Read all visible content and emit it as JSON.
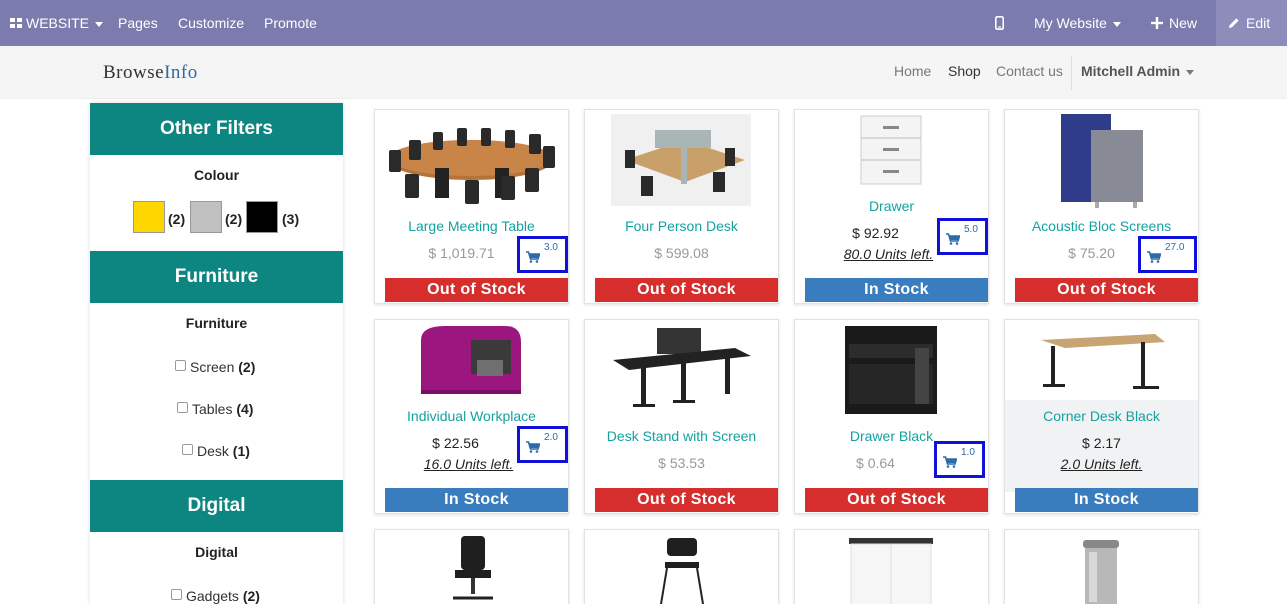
{
  "topbar": {
    "website_menu": "WEBSITE",
    "pages": "Pages",
    "customize": "Customize",
    "promote": "Promote",
    "my_website": "My Website",
    "new": "New",
    "edit": "Edit"
  },
  "nav": {
    "brand_a": "Browse",
    "brand_b": "Info",
    "home": "Home",
    "shop": "Shop",
    "contact": "Contact us",
    "user": "Mitchell Admin"
  },
  "sidebar": {
    "other_filters": "Other Filters",
    "colour_title": "Colour",
    "colours": [
      {
        "hex": "#ffd700",
        "count": "(2)"
      },
      {
        "hex": "#c0c0c0",
        "count": "(2)"
      },
      {
        "hex": "#000000",
        "count": "(3)"
      }
    ],
    "furniture_head": "Furniture",
    "furniture_sub": "Furniture",
    "furniture_items": [
      {
        "label": "Screen",
        "count": "(2)"
      },
      {
        "label": "Tables",
        "count": "(4)"
      },
      {
        "label": "Desk",
        "count": "(1)"
      }
    ],
    "digital_head": "Digital",
    "digital_sub": "Digital",
    "digital_items": [
      {
        "label": "Gadgets",
        "count": "(2)"
      }
    ]
  },
  "products": [
    {
      "name": "Large Meeting Table",
      "price": "$ 1,019.71",
      "stock": "Out of Stock",
      "cart_qty": "3.0",
      "image_icon": "meeting-table-image"
    },
    {
      "name": "Four Person Desk",
      "price": "$ 599.08",
      "stock": "Out of Stock",
      "image_icon": "four-person-desk-image"
    },
    {
      "name": "Drawer",
      "price": "$ 92.92",
      "units": "80.0 Units left.",
      "stock": "In Stock",
      "cart_qty": "5.0",
      "image_icon": "drawer-image"
    },
    {
      "name": "Acoustic Bloc Screens",
      "price": "$ 75.20",
      "stock": "Out of Stock",
      "cart_qty": "27.0",
      "image_icon": "acoustic-screens-image"
    },
    {
      "name": "Individual Workplace",
      "price": "$ 22.56",
      "units": "16.0 Units left.",
      "stock": "In Stock",
      "cart_qty": "2.0",
      "image_icon": "individual-workplace-image"
    },
    {
      "name": "Desk Stand with Screen",
      "price": "$ 53.53",
      "stock": "Out of Stock",
      "image_icon": "desk-stand-image"
    },
    {
      "name": "Drawer Black",
      "price": "$ 0.64",
      "stock": "Out of Stock",
      "cart_qty": "1.0",
      "image_icon": "drawer-black-image"
    },
    {
      "name": "Corner Desk Black",
      "price": "$ 2.17",
      "units": "2.0 Units left.",
      "stock": "In Stock",
      "image_icon": "corner-desk-image"
    }
  ],
  "bottom_row_images": [
    "office-chair-image",
    "stacking-chair-image",
    "cabinet-image",
    "trash-bin-image"
  ],
  "colors": {
    "admin_bar": "#7c7bad",
    "section_header": "#0d8580",
    "product_name": "#14a1a1",
    "out_of_stock": "#d62d2d",
    "in_stock": "#3a7dbf",
    "highlight_box": "#1010d8"
  }
}
